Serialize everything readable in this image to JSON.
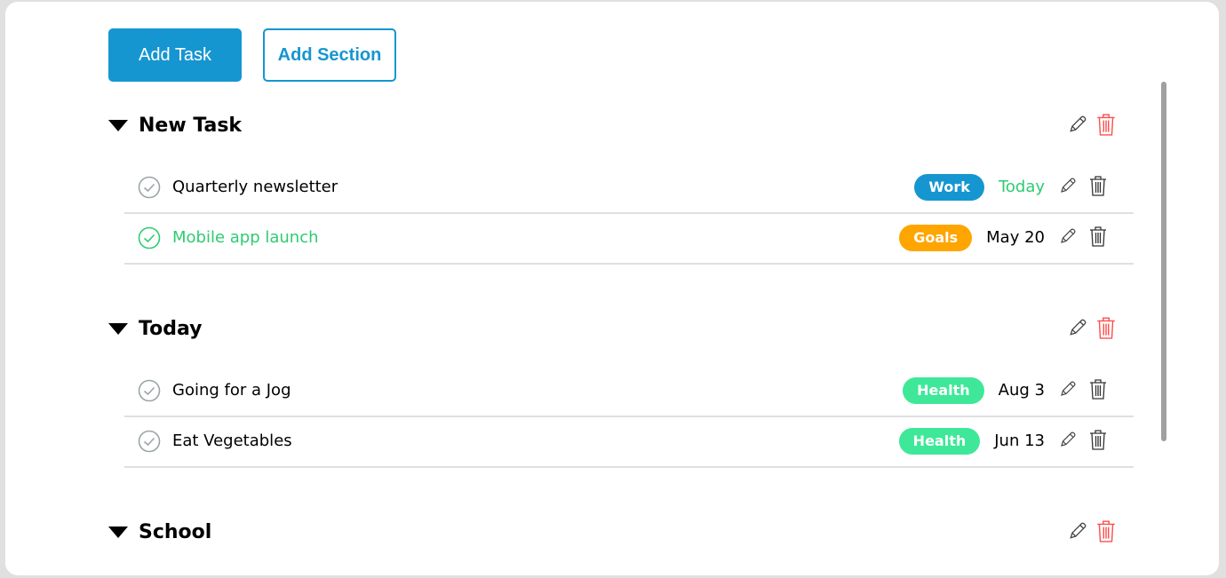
{
  "toolbar": {
    "add_task": "Add Task",
    "add_section": "Add Section"
  },
  "colors": {
    "accent": "#1696d0",
    "done": "#2ecc71",
    "delete_section": "#ff4d4d"
  },
  "sections": [
    {
      "title": "New Task",
      "tasks": [
        {
          "name": "Quarterly newsletter",
          "done": false,
          "tag": "Work",
          "tag_color": "#1696d0",
          "date": "Today",
          "date_today": true
        },
        {
          "name": "Mobile app launch",
          "done": true,
          "tag": "Goals",
          "tag_color": "#ffa500",
          "date": "May 20",
          "date_today": false
        }
      ]
    },
    {
      "title": "Today",
      "tasks": [
        {
          "name": "Going for a Jog",
          "done": false,
          "tag": "Health",
          "tag_color": "#3ee898",
          "date": "Aug 3",
          "date_today": false
        },
        {
          "name": "Eat Vegetables",
          "done": false,
          "tag": "Health",
          "tag_color": "#3ee898",
          "date": "Jun 13",
          "date_today": false
        }
      ]
    },
    {
      "title": "School",
      "tasks": []
    }
  ]
}
